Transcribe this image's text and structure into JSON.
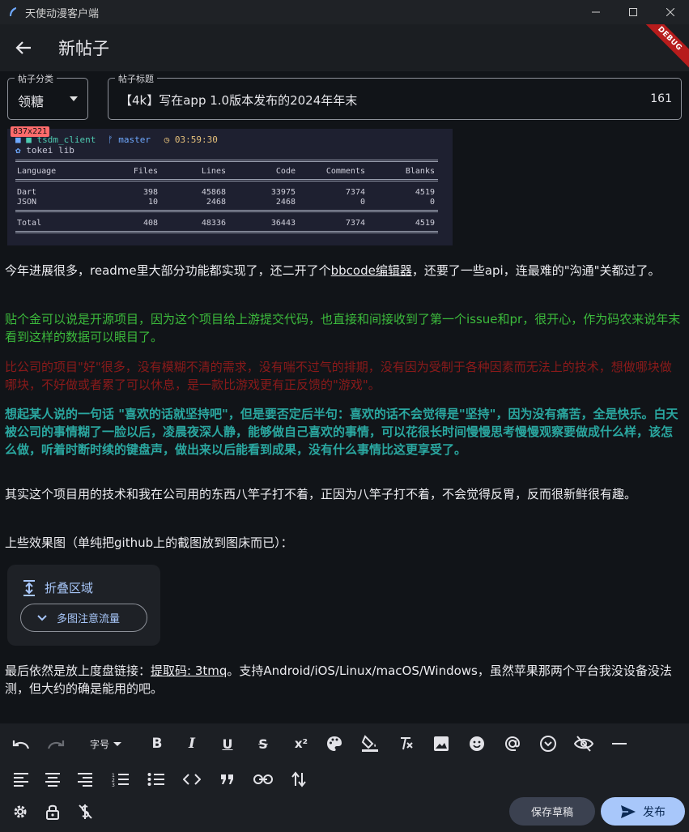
{
  "window": {
    "title": "天使动漫客户端"
  },
  "appbar": {
    "title": "新帖子",
    "debug_label": "DEBUG"
  },
  "form": {
    "category": {
      "label": "帖子分类",
      "value": "领糖"
    },
    "title": {
      "label": "帖子标题",
      "value": "【4k】写在app 1.0版本发布的2024年年末",
      "counter": "161"
    }
  },
  "image": {
    "size_badge": "837x221",
    "prompt": {
      "dir": "tsdm_client",
      "branch": "master",
      "time": "03:59:30"
    },
    "command": "tokei lib",
    "headers": [
      "Language",
      "Files",
      "Lines",
      "Code",
      "Comments",
      "Blanks"
    ],
    "rows": [
      [
        "Dart",
        "398",
        "45868",
        "33975",
        "7374",
        "4519"
      ],
      [
        "JSON",
        "10",
        "2468",
        "2468",
        "0",
        "0"
      ]
    ],
    "total": [
      "Total",
      "408",
      "48336",
      "36443",
      "7374",
      "4519"
    ]
  },
  "content": {
    "p1_a": "今年进展很多，readme里大部分功能都实现了，还二开了个",
    "p1_link": "bbcode编辑器",
    "p1_b": "，还要了一些api，连最难的\"沟通\"关都过了。",
    "p2": "贴个金可以说是开源项目，因为这个项目给上游提交代码，也直接和间接收到了第一个issue和pr，很开心，作为码农来说年末看到这样的数据可以眼目了。",
    "p3": "比公司的项目\"好\"很多，没有模糊不清的需求，没有喘不过气的排期，没有因为受制于各种因素而无法上的技术，想做哪块做哪块，不好做或者累了可以休息，是一款比游戏更有正反馈的\"游戏\"。",
    "p4": "想起某人说的一句话 \"喜欢的话就坚持吧\"，但是要否定后半句：喜欢的话不会觉得是\"坚持\"，因为没有痛苦，全是快乐。白天被公司的事情糊了一脸以后，凌晨夜深人静，能够做自己喜欢的事情，可以花很长时间慢慢思考慢慢观察要做成什么样，该怎么做，听着时断时续的键盘声，做出来以后能看到成果，没有什么事情比这更享受了。",
    "p5": "其实这个项目用的技术和我在公司用的东西八竿子打不着，正因为八竿子打不着，不会觉得反胃，反而很新鲜很有趣。",
    "p6": "上些效果图（单纯把github上的截图放到图床而已）：",
    "collapse": {
      "title": "折叠区域",
      "pill": "多图注意流量"
    },
    "p7_a": "最后依然是放上度盘链接：",
    "p7_link": "提取码: 3tmq",
    "p7_b": "。支持Android/iOS/Linux/macOS/Windows，虽然苹果那两个平台我没设备没法测，但大约的确是能用的吧。"
  },
  "toolbar": {
    "font_size_label": "字号",
    "superscript_label": "x²",
    "save_draft_label": "保存草稿",
    "publish_label": "发布"
  }
}
